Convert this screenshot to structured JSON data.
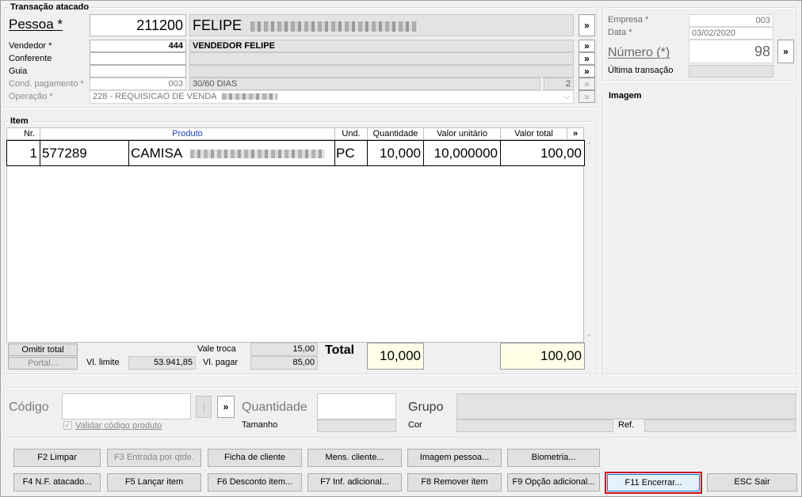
{
  "header": {
    "group_title": "Transação atacado",
    "pessoa_label": "Pessoa *",
    "pessoa_code": "211200",
    "pessoa_name": "FELIPE",
    "vendedor_label": "Vendedor *",
    "vendedor_code": "444",
    "vendedor_name": "VENDEDOR FELIPE",
    "conferente_label": "Conferente",
    "guia_label": "Guia",
    "cond_label": "Cond. pagamento *",
    "cond_code": "003",
    "cond_name": "30/60 DIAS",
    "cond_count": "2",
    "operacao_label": "Operação *",
    "operacao_value": "228 - REQUISICAO DE VENDA",
    "more_label": "»"
  },
  "side": {
    "empresa_label": "Empresa *",
    "empresa_value": "003",
    "data_label": "Data *",
    "data_value": "03/02/2020",
    "numero_label": "Número (*)",
    "numero_value": "98",
    "ultima_label": "Última transação",
    "imagem_title": "Imagem"
  },
  "items": {
    "group_title": "Item",
    "columns": [
      "Nr.",
      "Produto",
      "Und.",
      "Quantidade",
      "Valor unitário",
      "Valor total"
    ],
    "rows": [
      {
        "nr": "1",
        "code": "577289",
        "product": "CAMISA",
        "und": "PC",
        "qty": "10,000",
        "unit": "10,000000",
        "total": "100,00"
      }
    ],
    "omitir_label": "Omitir total",
    "portal_label": "Portal...",
    "vl_limite_label": "Vl. limite",
    "vl_limite_value": "53.941,85",
    "vale_troca_label": "Vale troca",
    "vale_troca_value": "15,00",
    "vl_pagar_label": "Vl. pagar",
    "vl_pagar_value": "85,00",
    "total_label": "Total",
    "total_qty": "10,000",
    "total_value": "100,00"
  },
  "entry": {
    "codigo_label": "Código",
    "validar_label": "Validar código produto",
    "quantidade_label": "Quantidade",
    "tamanho_label": "Tamanho",
    "grupo_label": "Grupo",
    "cor_label": "Cor",
    "ref_label": "Ref.",
    "pipe_label": "|"
  },
  "buttons": {
    "f2": "F2 Limpar",
    "f3": "F3 Entrada por qtde.",
    "ficha": "Ficha de cliente",
    "mens": "Mens. cliente...",
    "imagem": "Imagem pessoa...",
    "biometria": "Biometria...",
    "f4": "F4 N.F. atacado...",
    "f5": "F5 Lançar item",
    "f6": "F6 Desconto item...",
    "f7": "F7 Inf. adicional...",
    "f8": "F8 Remover item",
    "f9": "F9 Opção adicional...",
    "f11": "F11 Encerrar...",
    "esc": "ESC Sair"
  },
  "colors": {
    "highlight_border": "#d0101c",
    "total_bg": "#ffffe8",
    "readonly_bg": "#e3e3e3"
  }
}
